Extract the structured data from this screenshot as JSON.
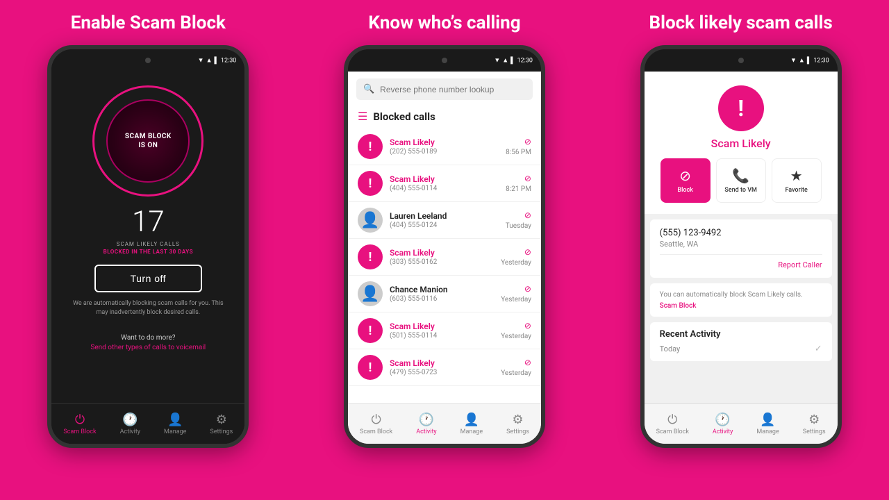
{
  "panels": [
    {
      "title": "Enable Scam Block",
      "phone_type": "dark",
      "screen": "scam-block",
      "status_time": "12:30",
      "scam_block_text1": "SCAM BLOCK",
      "scam_block_text2": "IS ON",
      "big_number": "17",
      "scam_likely_label": "SCAM LIKELY CALLS",
      "blocked_label": "BLOCKED IN THE LAST 30 DAYS",
      "turn_off_label": "Turn off",
      "auto_text": "We are automatically blocking scam calls for you. This may inadvertently block desired calls.",
      "want_more": "Want to do more?",
      "want_more_link": "Send other types of calls to voicemail",
      "nav": [
        {
          "label": "Scam Block",
          "active": true
        },
        {
          "label": "Activity",
          "active": false
        },
        {
          "label": "Manage",
          "active": false
        },
        {
          "label": "Settings",
          "active": false
        }
      ]
    },
    {
      "title": "Know who’s calling",
      "phone_type": "light",
      "screen": "call-list",
      "status_time": "12:30",
      "search_placeholder": "Reverse phone number lookup",
      "section_title": "Blocked calls",
      "calls": [
        {
          "name": "Scam Likely",
          "number": "(202) 555-0189",
          "time": "8:56 PM",
          "type": "scam"
        },
        {
          "name": "Scam Likely",
          "number": "(404) 555-0114",
          "time": "8:21 PM",
          "type": "scam"
        },
        {
          "name": "Lauren Leeland",
          "number": "(404) 555-0124",
          "time": "Tuesday",
          "type": "person"
        },
        {
          "name": "Scam Likely",
          "number": "(303) 555-0162",
          "time": "Yesterday",
          "type": "scam"
        },
        {
          "name": "Chance Manion",
          "number": "(603) 555-0116",
          "time": "Yesterday",
          "type": "person"
        },
        {
          "name": "Scam Likely",
          "number": "(501) 555-0114",
          "time": "Yesterday",
          "type": "scam"
        },
        {
          "name": "Scam Likely",
          "number": "(479) 555-0723",
          "time": "Yesterday",
          "type": "scam"
        }
      ],
      "nav": [
        {
          "label": "Scam Block",
          "active": false
        },
        {
          "label": "Activity",
          "active": true
        },
        {
          "label": "Manage",
          "active": false
        },
        {
          "label": "Settings",
          "active": false
        }
      ]
    },
    {
      "title": "Block likely scam calls",
      "phone_type": "light",
      "screen": "scam-detail",
      "status_time": "12:30",
      "scam_likely_title": "Scam Likely",
      "action_buttons": [
        {
          "label": "Block",
          "active": true
        },
        {
          "label": "Send to VM",
          "active": false
        },
        {
          "label": "Favorite",
          "active": false
        }
      ],
      "phone_number": "(555) 123-9492",
      "location": "Seattle, WA",
      "report_caller": "Report Caller",
      "auto_block_desc": "You can automatically block Scam Likely calls.",
      "scam_block_link": "Scam Block",
      "recent_activity_title": "Recent Activity",
      "today_label": "Today",
      "nav": [
        {
          "label": "Scam Block",
          "active": false
        },
        {
          "label": "Activity",
          "active": true
        },
        {
          "label": "Manage",
          "active": false
        },
        {
          "label": "Settings",
          "active": false
        }
      ]
    }
  ]
}
